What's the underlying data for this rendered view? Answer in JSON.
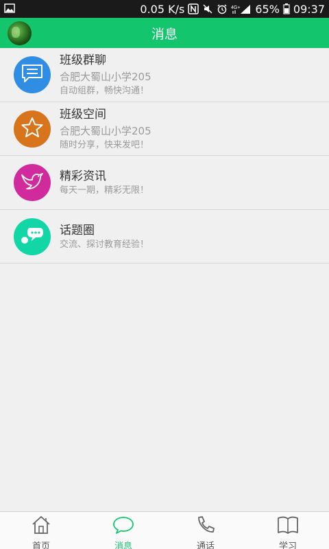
{
  "status": {
    "speed": "0.05 K/s",
    "battery": "65%",
    "time": "09:37"
  },
  "header": {
    "title": "消息"
  },
  "items": [
    {
      "title": "班级群聊",
      "subtitle": "合肥大蜀山小学205",
      "desc": "自动组群，畅快沟通！",
      "color": "#2f8de4",
      "icon": "chat-icon"
    },
    {
      "title": "班级空间",
      "subtitle": "合肥大蜀山小学205",
      "desc": "随时分享，快来发吧！",
      "color": "#d8741c",
      "icon": "star-icon"
    },
    {
      "title": "精彩资讯",
      "desc": "每天一期，精彩无限！",
      "color": "#d02a9c",
      "icon": "bird-icon"
    },
    {
      "title": "话题圈",
      "desc": "交流、探讨教育经验！",
      "color": "#12d6a6",
      "icon": "bubbles-icon"
    }
  ],
  "tabs": [
    {
      "label": "首页",
      "icon": "home-icon",
      "active": false
    },
    {
      "label": "消息",
      "icon": "message-icon",
      "active": true
    },
    {
      "label": "通话",
      "icon": "phone-icon",
      "active": false
    },
    {
      "label": "学习",
      "icon": "book-icon",
      "active": false
    }
  ],
  "colors": {
    "accent": "#13c66e"
  }
}
